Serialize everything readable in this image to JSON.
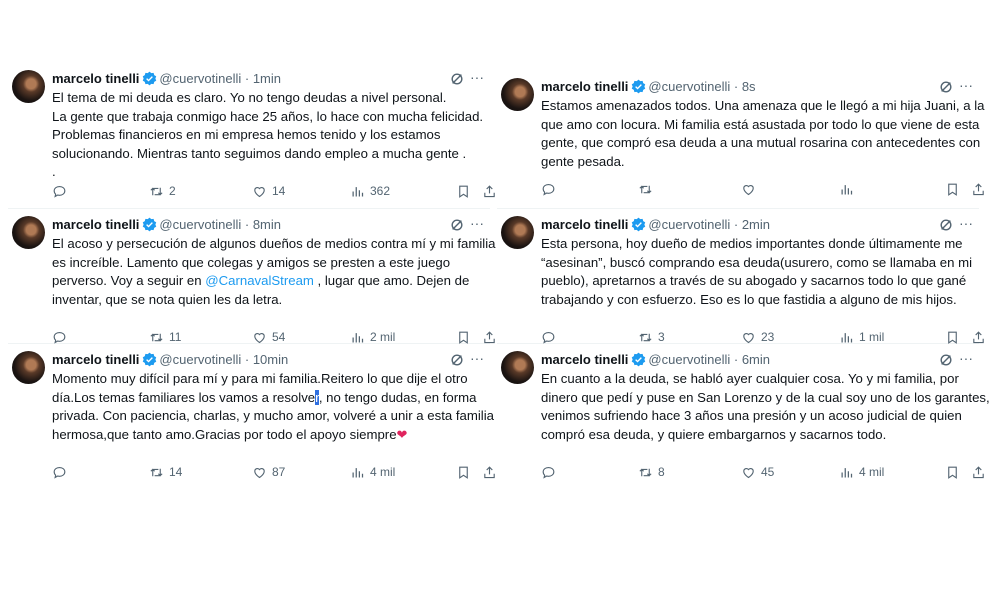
{
  "tweets": [
    {
      "name": "marcelo tinelli",
      "handle": "@cuervotinelli",
      "time": "1min",
      "lines": [
        "El tema de mi deuda es claro. Yo no tengo deudas a nivel personal.",
        "La gente que trabaja conmigo hace 25 años, lo  hace con mucha felicidad.",
        "Problemas financieros en  mi empresa hemos tenido y los estamos",
        "solucionando. Mientras tanto seguimos  dando empleo a mucha gente .",
        "."
      ],
      "retweets": "2",
      "likes": "14",
      "views": "362"
    },
    {
      "name": "marcelo tinelli",
      "handle": "@cuervotinelli",
      "time": "8min",
      "lines": [
        "El acoso y persecución de algunos dueños de medios contra mí y mi familia",
        "es increíble. Lamento que colegas y amigos se presten a este juego",
        "perverso. Voy a seguir en ",
        "inventar, que se nota quien les da letra."
      ],
      "link": "@CarnavalStream",
      "line3_after": " , lugar que amo. Dejen de",
      "retweets": "11",
      "likes": "54",
      "views": "2 mil"
    },
    {
      "name": "marcelo tinelli",
      "handle": "@cuervotinelli",
      "time": "10min",
      "lines": [
        "Momento muy difícil para mí y para mi familia.Reitero lo que dije el otro",
        "día.Los temas familiares los vamos a resolve",
        "privada. Con paciencia, charlas, y mucho amor, volveré a unir a esta familia",
        "hermosa,que tanto amo.Gracias por todo el apoyo siempre"
      ],
      "cursor_char": "r",
      "line2_after": ", no tengo dudas, en forma",
      "emoji": "❤",
      "retweets": "14",
      "likes": "87",
      "views": "4 mil"
    },
    {
      "name": "marcelo tinelli",
      "handle": "@cuervotinelli",
      "time": "8s",
      "lines": [
        "Estamos amenazados todos. Una amenaza que le llegó a mi hija Juani, a la",
        "que amo con locura. Mi familia está asustada por todo lo que viene de esta",
        "gente, que compró esa deuda a una mutual rosarina con antecedentes con",
        "gente pesada."
      ],
      "retweets": "",
      "likes": "",
      "views": ""
    },
    {
      "name": "marcelo tinelli",
      "handle": "@cuervotinelli",
      "time": "2min",
      "lines": [
        "Esta persona, hoy dueño de medios importantes donde últimamente me",
        "“asesinan”, buscó comprando esa deuda(usurero, como se llamaba en mi",
        "pueblo), apretarnos a través de su abogado y sacarnos todo lo que gané",
        "trabajando y con esfuerzo. Eso es lo que fastidia a alguno de mis hijos."
      ],
      "retweets": "3",
      "likes": "23",
      "views": "1 mil"
    },
    {
      "name": "marcelo tinelli",
      "handle": "@cuervotinelli",
      "time": "6min",
      "lines": [
        "En cuanto a la deuda, se habló ayer cualquier cosa. Yo y mi familia, por",
        "dinero que pedí y puse en San Lorenzo y de la cual soy uno de los garantes,",
        "venimos sufriendo hace 3 años una presión y un acoso judicial de quien",
        "compró esa deuda, y quiere embargarnos y sacarnos todo."
      ],
      "retweets": "8",
      "likes": "45",
      "views": "4 mil"
    }
  ],
  "colors": {
    "text": "#0f1419",
    "muted": "#536471",
    "link": "#1d9bf0",
    "verified": "#1d9bf0",
    "divider": "#eff3f4"
  },
  "icons": [
    "verified-badge-icon",
    "grok-icon",
    "more-icon",
    "reply-icon",
    "retweet-icon",
    "like-icon",
    "views-icon",
    "bookmark-icon",
    "share-icon"
  ]
}
